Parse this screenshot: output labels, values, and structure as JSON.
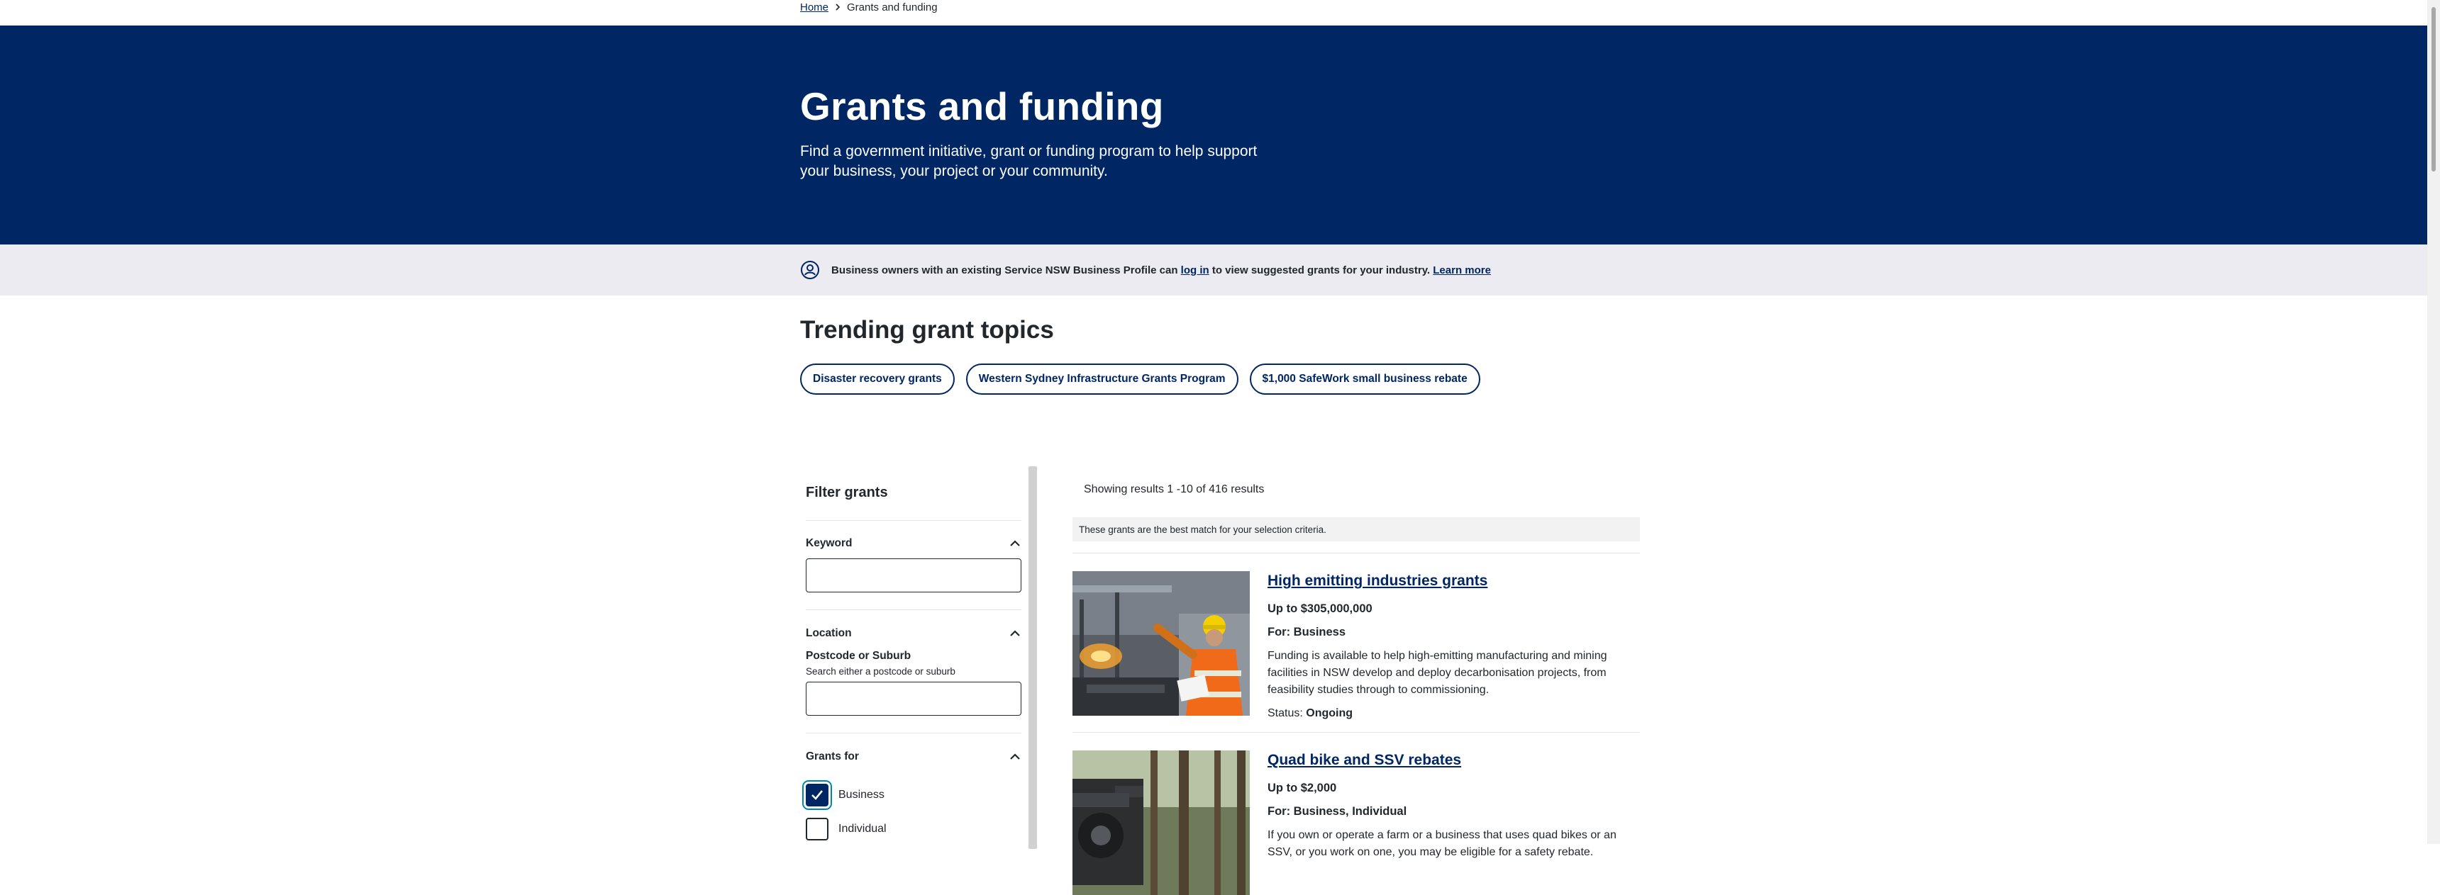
{
  "breadcrumb": {
    "home": "Home",
    "current": "Grants and funding"
  },
  "hero": {
    "title": "Grants and funding",
    "subtitle": "Find a government initiative, grant or funding program to help support your business, your project or your community."
  },
  "notice": {
    "text_before": "Business owners with an existing Service NSW Business Profile can ",
    "login_link": "log in",
    "text_after": " to view suggested grants for your industry. ",
    "learn_more": "Learn more"
  },
  "trending": {
    "title": "Trending grant topics",
    "topics": [
      "Disaster recovery grants",
      "Western Sydney Infrastructure Grants Program",
      "$1,000 SafeWork small business rebate"
    ]
  },
  "filter": {
    "title": "Filter grants",
    "keyword": {
      "label": "Keyword",
      "value": ""
    },
    "location": {
      "label": "Location",
      "field_label": "Postcode or Suburb",
      "hint": "Search either a postcode or suburb",
      "value": ""
    },
    "grants_for": {
      "label": "Grants for",
      "options": [
        {
          "label": "Business",
          "checked": true
        },
        {
          "label": "Individual",
          "checked": false
        }
      ]
    }
  },
  "results": {
    "count_text": "Showing results 1 -10 of 416 results",
    "best_match_text": "These grants are the best match for your selection criteria.",
    "items": [
      {
        "title": "High emitting industries grants",
        "amount": "Up to $305,000,000",
        "for": "For: Business",
        "description": "Funding is available to help high-emitting manufacturing and mining facilities in NSW develop and deploy decarbonisation projects, from feasibility studies through to commissioning.",
        "status_label": "Status:",
        "status_value": "Ongoing"
      },
      {
        "title": "Quad bike and SSV rebates",
        "amount": "Up to $2,000",
        "for": "For: Business, Individual",
        "description": "If you own or operate a farm or a business that uses quad bikes or an SSV, or you work on one, you may be eligible for a safety rebate."
      }
    ]
  },
  "colors": {
    "brand_navy": "#002664",
    "notice_bg": "#ebebf1",
    "text": "#22272b",
    "focus_ring": "#0085b3"
  }
}
